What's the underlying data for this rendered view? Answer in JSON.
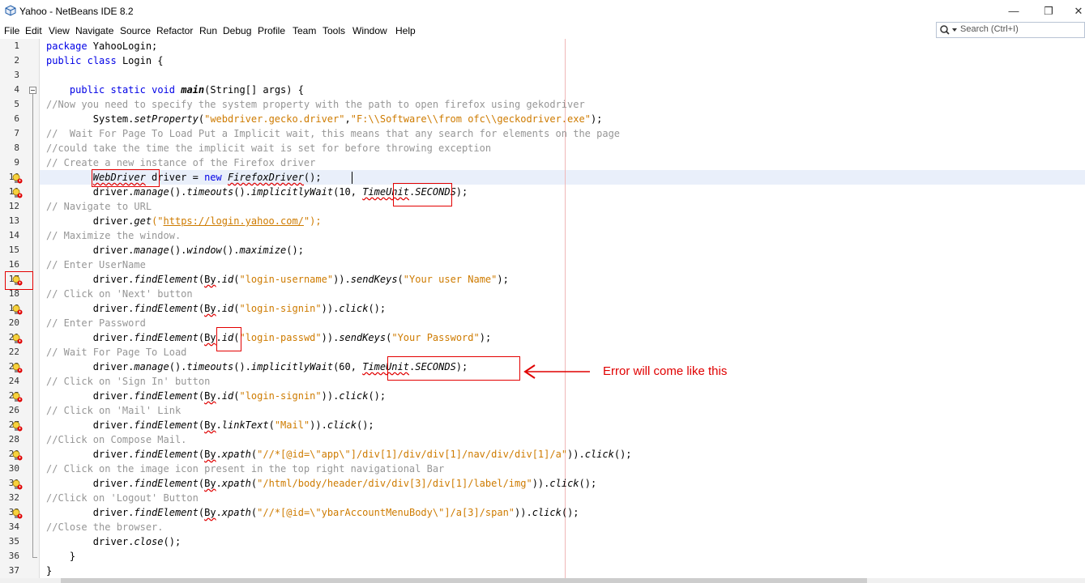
{
  "window": {
    "title": "Yahoo - NetBeans IDE 8.2",
    "controls": {
      "minimize": "—",
      "maximize": "❐",
      "close": "✕"
    }
  },
  "menu": [
    "File",
    "Edit",
    "View",
    "Navigate",
    "Source",
    "Refactor",
    "Run",
    "Debug",
    "Profile",
    "Team",
    "Tools",
    "Window",
    "Help"
  ],
  "search": {
    "placeholder": "Search (Ctrl+I)"
  },
  "colors": {
    "keyword": "#0000e6",
    "string": "#ce7b00",
    "comment": "#969696",
    "error": "#e00000"
  },
  "editor": {
    "line_numbers": [
      "1",
      "2",
      "3",
      "4",
      "5",
      "6",
      "7",
      "8",
      "9",
      "10",
      "11",
      "12",
      "13",
      "14",
      "15",
      "16",
      "17",
      "18",
      "19",
      "20",
      "21",
      "22",
      "23",
      "24",
      "25",
      "26",
      "27",
      "28",
      "29",
      "30",
      "31",
      "32",
      "33",
      "34",
      "35",
      "36",
      "37"
    ],
    "lines": {
      "l1": [
        "package",
        " YahooLogin;"
      ],
      "l2": [
        "public",
        " ",
        "class",
        " Login {"
      ],
      "l4": [
        "    ",
        "public",
        " ",
        "static",
        " ",
        "void",
        " ",
        "main",
        "(String[] args) {"
      ],
      "l5": [
        "//Now you need to specify the system property with the path to open firefox using gekodriver"
      ],
      "l6": [
        "        System.",
        "setProperty",
        "(",
        "\"webdriver.gecko.driver\"",
        ",",
        "\"F:\\\\Software\\\\from ofc\\\\geckodriver.exe\"",
        ");"
      ],
      "l7": [
        "//  Wait For Page To Load Put a Implicit wait, this means that any search for elements on the page"
      ],
      "l8": [
        "//could take the time the implicit wait is set for before throwing exception"
      ],
      "l9": [
        "// Create a new instance of the Firefox driver"
      ],
      "l10": [
        "        ",
        "WebDriver",
        " driver = ",
        "new",
        " ",
        "FirefoxDriver",
        "();"
      ],
      "l11": [
        "        driver.",
        "manage",
        "().",
        "timeouts",
        "().",
        "implicitlyWait",
        "(10, ",
        "TimeUnit",
        ".",
        "SECONDS",
        ");"
      ],
      "l12": [
        "// Navigate to URL"
      ],
      "l13": [
        "        driver.",
        "get",
        "(\"",
        "https://login.yahoo.com/",
        "\");"
      ],
      "l14": [
        "// Maximize the window."
      ],
      "l15": [
        "        driver.",
        "manage",
        "().",
        "window",
        "().",
        "maximize",
        "();"
      ],
      "l16": [
        "// Enter UserName"
      ],
      "l17": [
        "        driver.",
        "findElement",
        "(",
        "By",
        ".",
        "id",
        "(",
        "\"login-username\"",
        ")).",
        "sendKeys",
        "(",
        "\"Your user Name\"",
        ");"
      ],
      "l18": [
        "// Click on 'Next' button"
      ],
      "l19": [
        "        driver.",
        "findElement",
        "(",
        "By",
        ".",
        "id",
        "(",
        "\"login-signin\"",
        ")).",
        "click",
        "();"
      ],
      "l20": [
        "// Enter Password"
      ],
      "l21": [
        "        driver.",
        "findElement",
        "(",
        "By",
        ".",
        "id",
        "(",
        "\"login-passwd\"",
        ")).",
        "sendKeys",
        "(",
        "\"Your Password\"",
        ");"
      ],
      "l22": [
        "// Wait For Page To Load"
      ],
      "l23": [
        "        driver.",
        "manage",
        "().",
        "timeouts",
        "().",
        "implicitlyWait",
        "(60, ",
        "TimeUnit",
        ".",
        "SECONDS",
        ");"
      ],
      "l24": [
        "// Click on 'Sign In' button"
      ],
      "l25": [
        "        driver.",
        "findElement",
        "(",
        "By",
        ".",
        "id",
        "(",
        "\"login-signin\"",
        ")).",
        "click",
        "();"
      ],
      "l26": [
        "// Click on 'Mail' Link"
      ],
      "l27": [
        "        driver.",
        "findElement",
        "(",
        "By",
        ".",
        "linkText",
        "(",
        "\"Mail\"",
        ")).",
        "click",
        "();"
      ],
      "l28": [
        "//Click on Compose Mail."
      ],
      "l29": [
        "        driver.",
        "findElement",
        "(",
        "By",
        ".",
        "xpath",
        "(",
        "\"//*[@id=\\\"app\\\"]/div[1]/div/div[1]/nav/div/div[1]/a\"",
        ")).",
        "click",
        "();"
      ],
      "l30": [
        "// Click on the image icon present in the top right navigational Bar"
      ],
      "l31": [
        "        driver.",
        "findElement",
        "(",
        "By",
        ".",
        "xpath",
        "(",
        "\"/html/body/header/div/div[3]/div[1]/label/img\"",
        ")).",
        "click",
        "();"
      ],
      "l32": [
        "//Click on 'Logout' Button"
      ],
      "l33": [
        "        driver.",
        "findElement",
        "(",
        "By",
        ".",
        "xpath",
        "(",
        "\"//*[@id=\\\"ybarAccountMenuBody\\\"]/a[3]/span\"",
        ")).",
        "click",
        "();"
      ],
      "l34": [
        "//Close the browser."
      ],
      "l35": [
        "        driver.",
        "close",
        "();"
      ],
      "l36": [
        "    }"
      ],
      "l37": [
        "}"
      ]
    }
  },
  "annotation": {
    "text": "Error will come like this"
  }
}
